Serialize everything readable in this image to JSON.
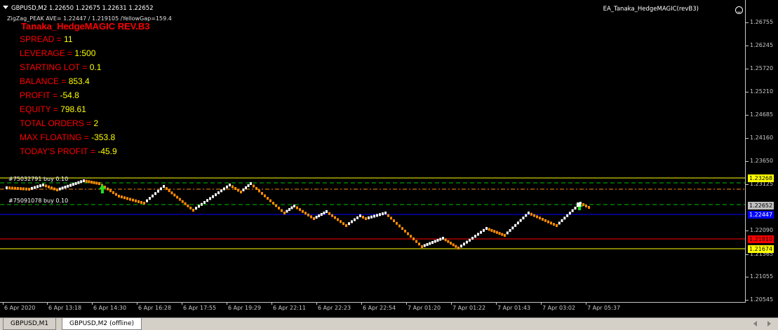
{
  "chart": {
    "symbol_line": "GBPUSD,M2  1.22650 1.22675 1.22631 1.22652",
    "indicator_line": "ZigZag_PEAK AVE= 1.22447 / 1.219105 /YellowGap=159.4",
    "ea_name": "EA_Tanaka_HedgeMAGIC(revB3)",
    "ea_title": "Tanaka_HedgeMAGIC REV.B3",
    "stats": [
      {
        "key": "SPREAD = ",
        "value": "11"
      },
      {
        "key": "LEVERAGE = ",
        "value": "1:500"
      },
      {
        "key": "STARTING LOT = ",
        "value": " 0.1"
      },
      {
        "key": "BALANCE = ",
        "value": " 853.4"
      },
      {
        "key": "PROFIT = ",
        "value": " -54.8"
      },
      {
        "key": "EQUITY = ",
        "value": " 798.61"
      },
      {
        "key": "TOTAL ORDERS = ",
        "value": "2"
      },
      {
        "key": "MAX FLOATING = ",
        "value": "-353.8"
      },
      {
        "key": "TODAY'S PROFIT = ",
        "value": "-45.9"
      }
    ],
    "order_labels": [
      "#75032791 buy 0.10",
      "#75091078 buy 0.10"
    ],
    "price_axis": [
      "1.26755",
      "1.26245",
      "1.25720",
      "1.25210",
      "1.24685",
      "1.24160",
      "1.23650",
      "1.23125",
      "1.22090",
      "1.21565",
      "1.21055",
      "1.20545"
    ],
    "price_tags": [
      {
        "label": "1.23268",
        "bg": "#ffff00",
        "fg": "#000000"
      },
      {
        "label": "1.22652",
        "bg": "#c0c0c0",
        "fg": "#000000"
      },
      {
        "label": "1.22447",
        "bg": "#0000ff",
        "fg": "#ffffff"
      },
      {
        "label": "1.21910",
        "bg": "#ff0000",
        "fg": "#000000"
      },
      {
        "label": "1.21674",
        "bg": "#ffff00",
        "fg": "#000000"
      }
    ],
    "time_axis": [
      "6 Apr 2020",
      "6 Apr 13:18",
      "6 Apr 14:30",
      "6 Apr 16:28",
      "6 Apr 17:55",
      "6 Apr 19:29",
      "6 Apr 22:11",
      "6 Apr 22:23",
      "6 Apr 22:54",
      "7 Apr 01:20",
      "7 Apr 01:22",
      "7 Apr 01:43",
      "7 Apr 03:02",
      "7 Apr 05:37"
    ],
    "colors": {
      "background": "#000000",
      "bull_candle": "#ffffff",
      "bear_candle": "#ff8c00",
      "yellow_line": "#ffff00",
      "red_line": "#ff0000",
      "blue_line": "#0000ff",
      "green_dash": "#00c000"
    }
  },
  "tabs": [
    {
      "label": "GBPUSD,M1",
      "active": false
    },
    {
      "label": "GBPUSD,M2 (offline)",
      "active": true
    }
  ]
}
